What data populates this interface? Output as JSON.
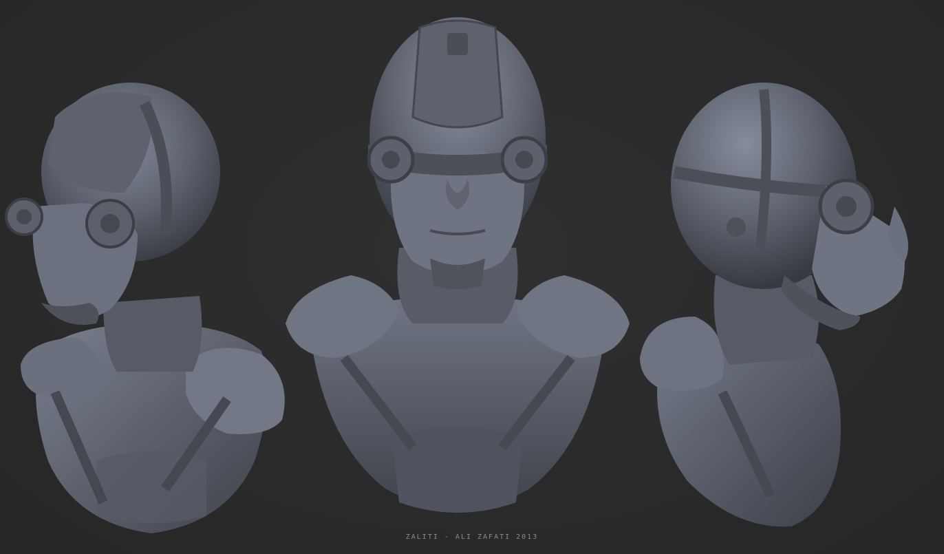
{
  "caption": "ZALITI - ALI ZAFATI 2013",
  "colors": {
    "background": "#2b2b2c",
    "clay_light": "#7c8291",
    "clay_mid": "#5a5f6b",
    "clay_dark": "#363a42",
    "caption_text": "#8a8c92"
  },
  "views": [
    {
      "name": "three-quarter-left-view"
    },
    {
      "name": "front-view"
    },
    {
      "name": "profile-right-view"
    }
  ]
}
